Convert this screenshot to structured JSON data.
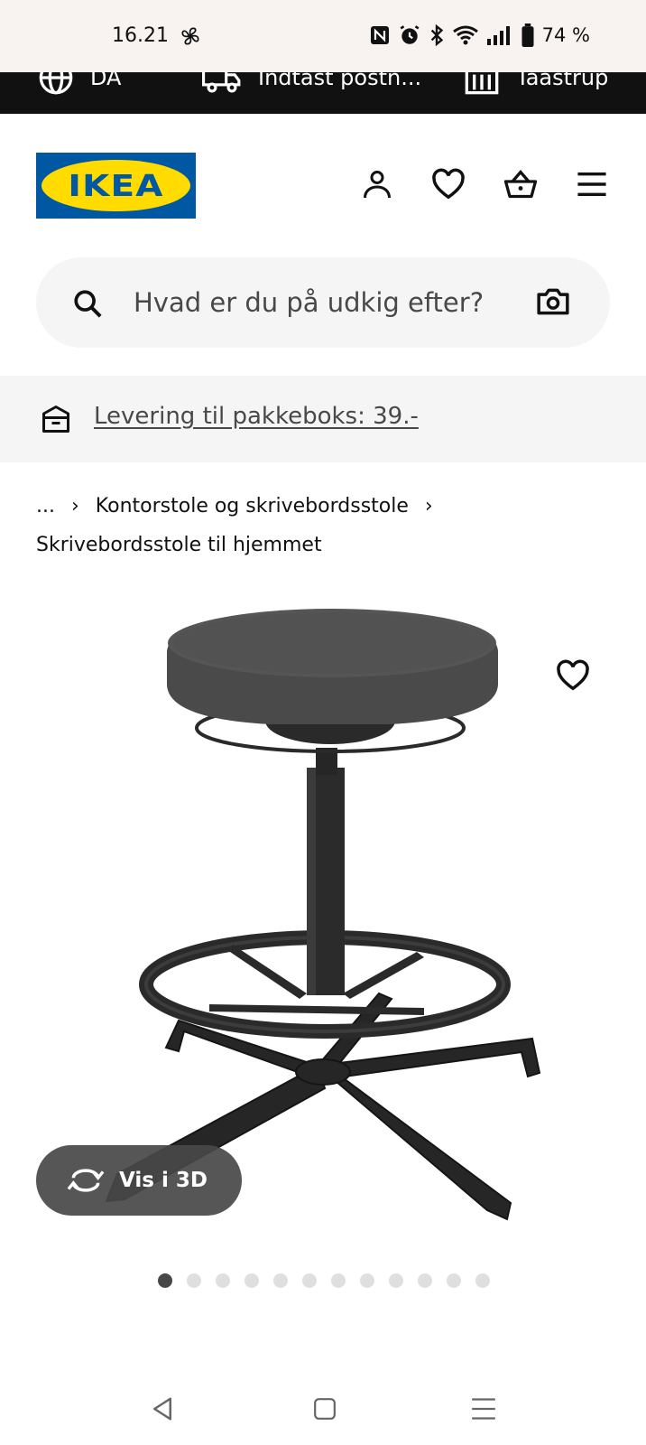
{
  "status_bar": {
    "time": "16.21",
    "battery": "74 %",
    "icons": [
      "fan-icon",
      "nfc-icon",
      "alarm-icon",
      "bluetooth-icon",
      "wifi-icon",
      "signal-icon",
      "battery-icon"
    ]
  },
  "top_strip": {
    "language": "DA",
    "postcode": "Indtast postn...",
    "store": "Taastrup"
  },
  "header": {
    "logo_text": "IKEA",
    "icons": [
      "account-icon",
      "heart-icon",
      "basket-icon",
      "menu-icon"
    ]
  },
  "search": {
    "placeholder": "Hvad er du på udkig efter?"
  },
  "delivery": {
    "link_text": "Levering til pakkeboks: 39.-"
  },
  "breadcrumb": {
    "ellipsis": "...",
    "items": [
      "Kontorstole og skrivebordsstole",
      "Skrivebordsstole til hjemmet"
    ]
  },
  "product": {
    "view_3d_label": "Vis i 3D",
    "image_count": 12,
    "active_image_index": 0
  },
  "colors": {
    "ikea_blue": "#0058a3",
    "ikea_yellow": "#ffdb00",
    "top_strip": "#111111",
    "search_bg": "#f5f5f5"
  }
}
